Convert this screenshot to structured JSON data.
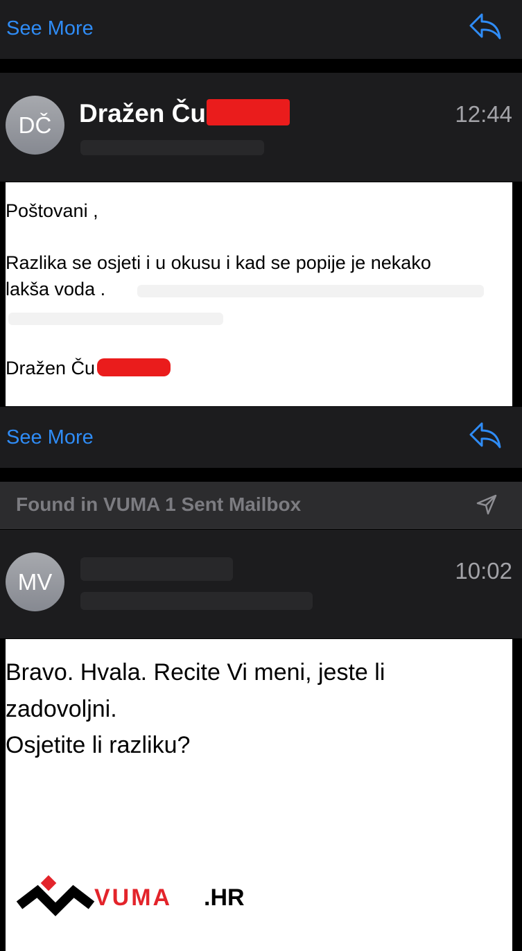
{
  "thread": {
    "see_more_label": "See More",
    "found_banner": "Found in VUMA 1 Sent Mailbox",
    "messages": [
      {
        "avatar_initials": "DČ",
        "sender": "Dražen Ču",
        "time": "12:44",
        "body": {
          "greeting": "Poštovani ,",
          "line1": "Razlika se osjeti i u okusu i kad se popije je nekako",
          "line2": "lakša voda .",
          "signature": "Dražen Ču"
        }
      },
      {
        "avatar_initials": "MV",
        "time": "10:02",
        "body": {
          "line1": "Bravo. Hvala. Recite Vi meni, jeste li",
          "line2": "zadovoljni.",
          "line3": "Osjetite li razliku?"
        },
        "logo_text": "VUMA",
        "logo_suffix": ".HR"
      }
    ]
  },
  "colors": {
    "accent": "#2f8cf6",
    "background": "#1c1c1e",
    "redaction": "#ea1c1c",
    "logo_red": "#e3242b"
  },
  "icons": [
    "reply-icon",
    "send-icon"
  ]
}
